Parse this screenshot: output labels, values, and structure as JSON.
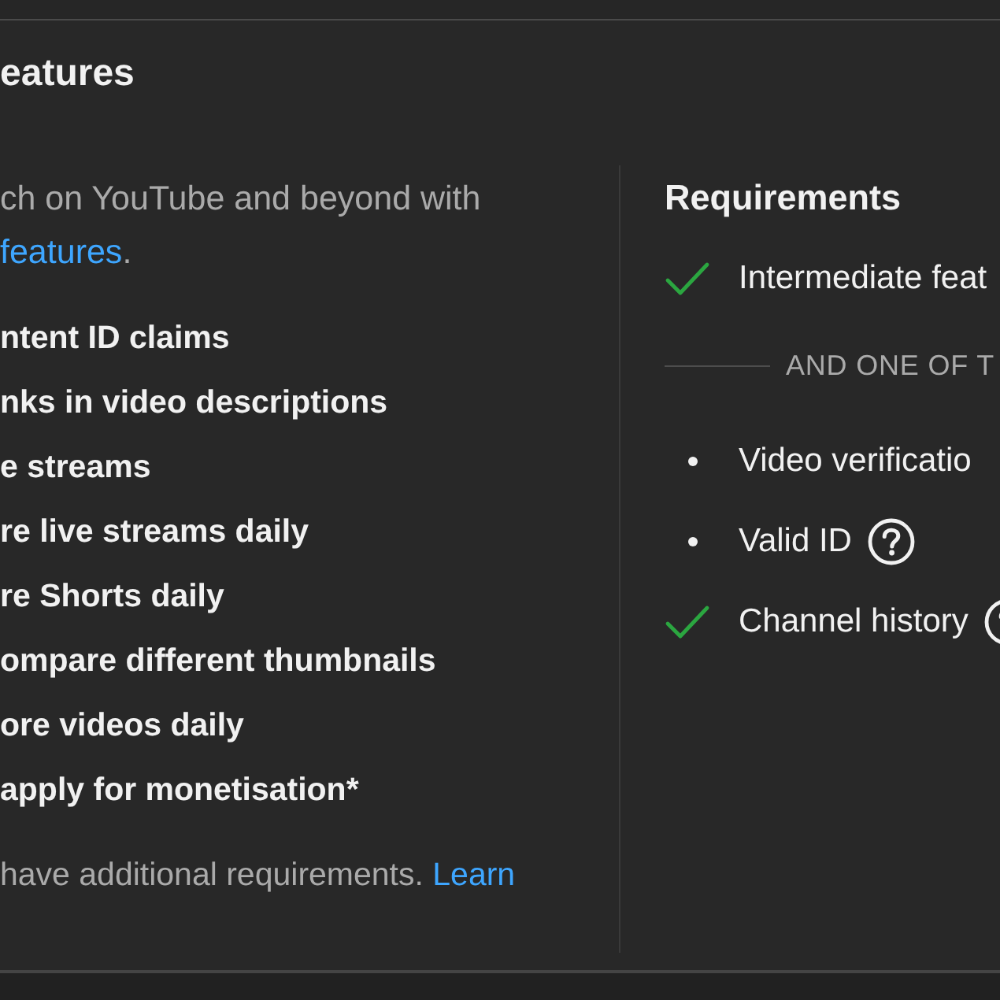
{
  "header": {
    "title": "eatures"
  },
  "features_panel": {
    "description": {
      "text": "ch on YouTube and beyond with",
      "link": "features",
      "after": "."
    },
    "features": [
      "ntent ID claims",
      "nks in video descriptions",
      "e streams",
      "re live streams daily",
      "re Shorts daily",
      "ompare different thumbnails",
      "ore videos daily",
      "apply for monetisation*"
    ],
    "footnote": {
      "text": "have additional requirements.",
      "link": "Learn"
    }
  },
  "requirements": {
    "title": "Requirements",
    "items": [
      {
        "label": "Intermediate feat",
        "met": true
      }
    ],
    "divider_label": "AND ONE OF T",
    "options": [
      {
        "label": "Video verificatio",
        "met": false
      },
      {
        "label": "Valid ID",
        "met": false,
        "help": true
      },
      {
        "label": "Channel history",
        "met": true,
        "help": true
      }
    ]
  }
}
